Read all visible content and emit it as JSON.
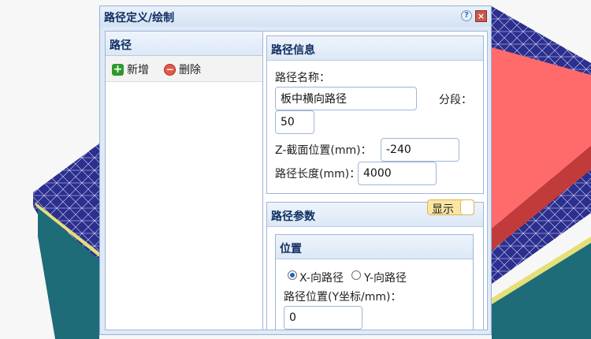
{
  "dialog": {
    "title": "路径定义/绘制",
    "help_icon": "?",
    "close_icon": "×"
  },
  "left_panel": {
    "title": "路径",
    "add_label": "新增",
    "delete_label": "删除",
    "add_icon_name": "plus-icon",
    "delete_icon_name": "minus-icon"
  },
  "path_info": {
    "title": "路径信息",
    "name_label": "路径名称：",
    "name_value": "板中横向路径",
    "segments_label": "分段：",
    "segments_value": "50",
    "z_label": "Z-截面位置(mm)：",
    "z_value": "-240",
    "length_label": "路径长度(mm)：",
    "length_value": "4000"
  },
  "path_params": {
    "title": "路径参数",
    "show_toggle": "显示",
    "position": {
      "title": "位置",
      "x_option": "X-向路径",
      "y_option": "Y-向路径",
      "selected": "X-向路径",
      "y_position_label": "路径位置(Y坐标/mm)：",
      "y_position_value": "0"
    }
  },
  "colors": {
    "slab_red": "#ff6b6b",
    "mesh_blue": "#2b2f8f",
    "teal_side": "#1f6f7a",
    "yellow_edge": "#e8e07a"
  }
}
